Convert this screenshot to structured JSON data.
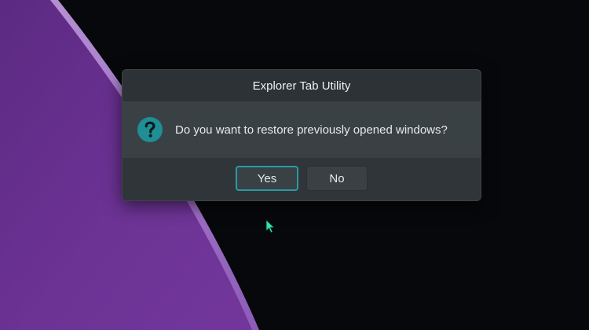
{
  "dialog": {
    "title": "Explorer Tab Utility",
    "message": "Do you want to restore previously opened windows?",
    "icon": "question-icon",
    "buttons": {
      "yes_label": "Yes",
      "no_label": "No"
    }
  },
  "theme": {
    "accent": "#2a9aa3",
    "icon_color": "#1f8e95",
    "wallpaper_color": "#6a2f8e",
    "background": "#07080b",
    "cursor_color": "#33e0a8"
  }
}
